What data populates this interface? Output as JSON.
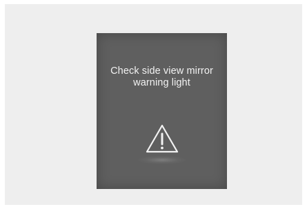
{
  "warning_screen": {
    "message_line1": "Check side view mirror",
    "message_line2": "warning light",
    "icon": "warning-triangle-icon",
    "colors": {
      "page_background": "#eeeeee",
      "screen_background": "#5f5f5f",
      "text": "#f2f2f2",
      "icon": "#f2f2f2"
    }
  }
}
